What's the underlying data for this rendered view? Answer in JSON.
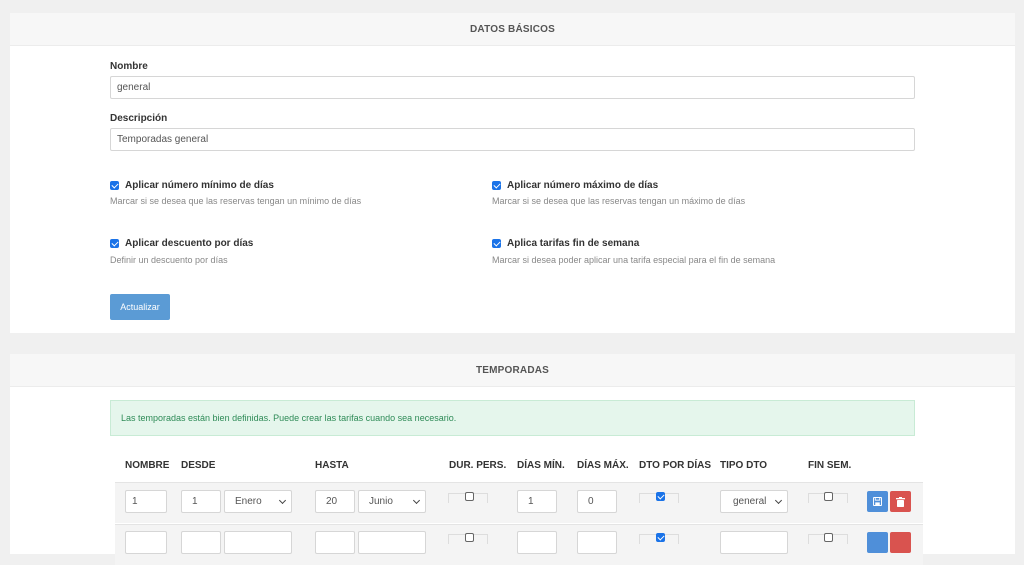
{
  "basic": {
    "header": "DATOS BÁSICOS",
    "name_label": "Nombre",
    "name_value": "general",
    "desc_label": "Descripción",
    "desc_value": "Temporadas general",
    "options": [
      {
        "label": "Aplicar número mínimo de días",
        "help": "Marcar si se desea que las reservas tengan un mínimo de días",
        "checked": true
      },
      {
        "label": "Aplicar número máximo de días",
        "help": "Marcar si se desea que las reservas tengan un máximo de días",
        "checked": true
      },
      {
        "label": "Aplicar descuento por días",
        "help": "Definir un descuento por días",
        "checked": true
      },
      {
        "label": "Aplica tarifas fin de semana",
        "help": "Marcar si desea poder aplicar una tarifa especial para el fin de semana",
        "checked": true
      }
    ],
    "update_button": "Actualizar"
  },
  "seasons": {
    "header": "TEMPORADAS",
    "alert": "Las temporadas están bien definidas. Puede crear las tarifas cuando sea necesario.",
    "columns": [
      "NOMBRE",
      "DESDE",
      "HASTA",
      "DUR. PERS.",
      "DÍAS MÍN.",
      "DÍAS MÁX.",
      "DTO POR DÍAS",
      "TIPO DTO",
      "FIN SEM."
    ],
    "rows": [
      {
        "name": "1",
        "from_day": "1",
        "from_month": "Enero",
        "to_day": "20",
        "to_month": "Junio",
        "custom_duration": false,
        "min_days": "1",
        "max_days": "0",
        "day_discount": true,
        "discount_type": "general",
        "weekend": false
      }
    ]
  },
  "colors": {
    "primary": "#5b9bd5",
    "danger": "#d9534f",
    "success_bg": "#e5f6ec",
    "success_text": "#2e8b57",
    "checkbox": "#1a73e8"
  }
}
